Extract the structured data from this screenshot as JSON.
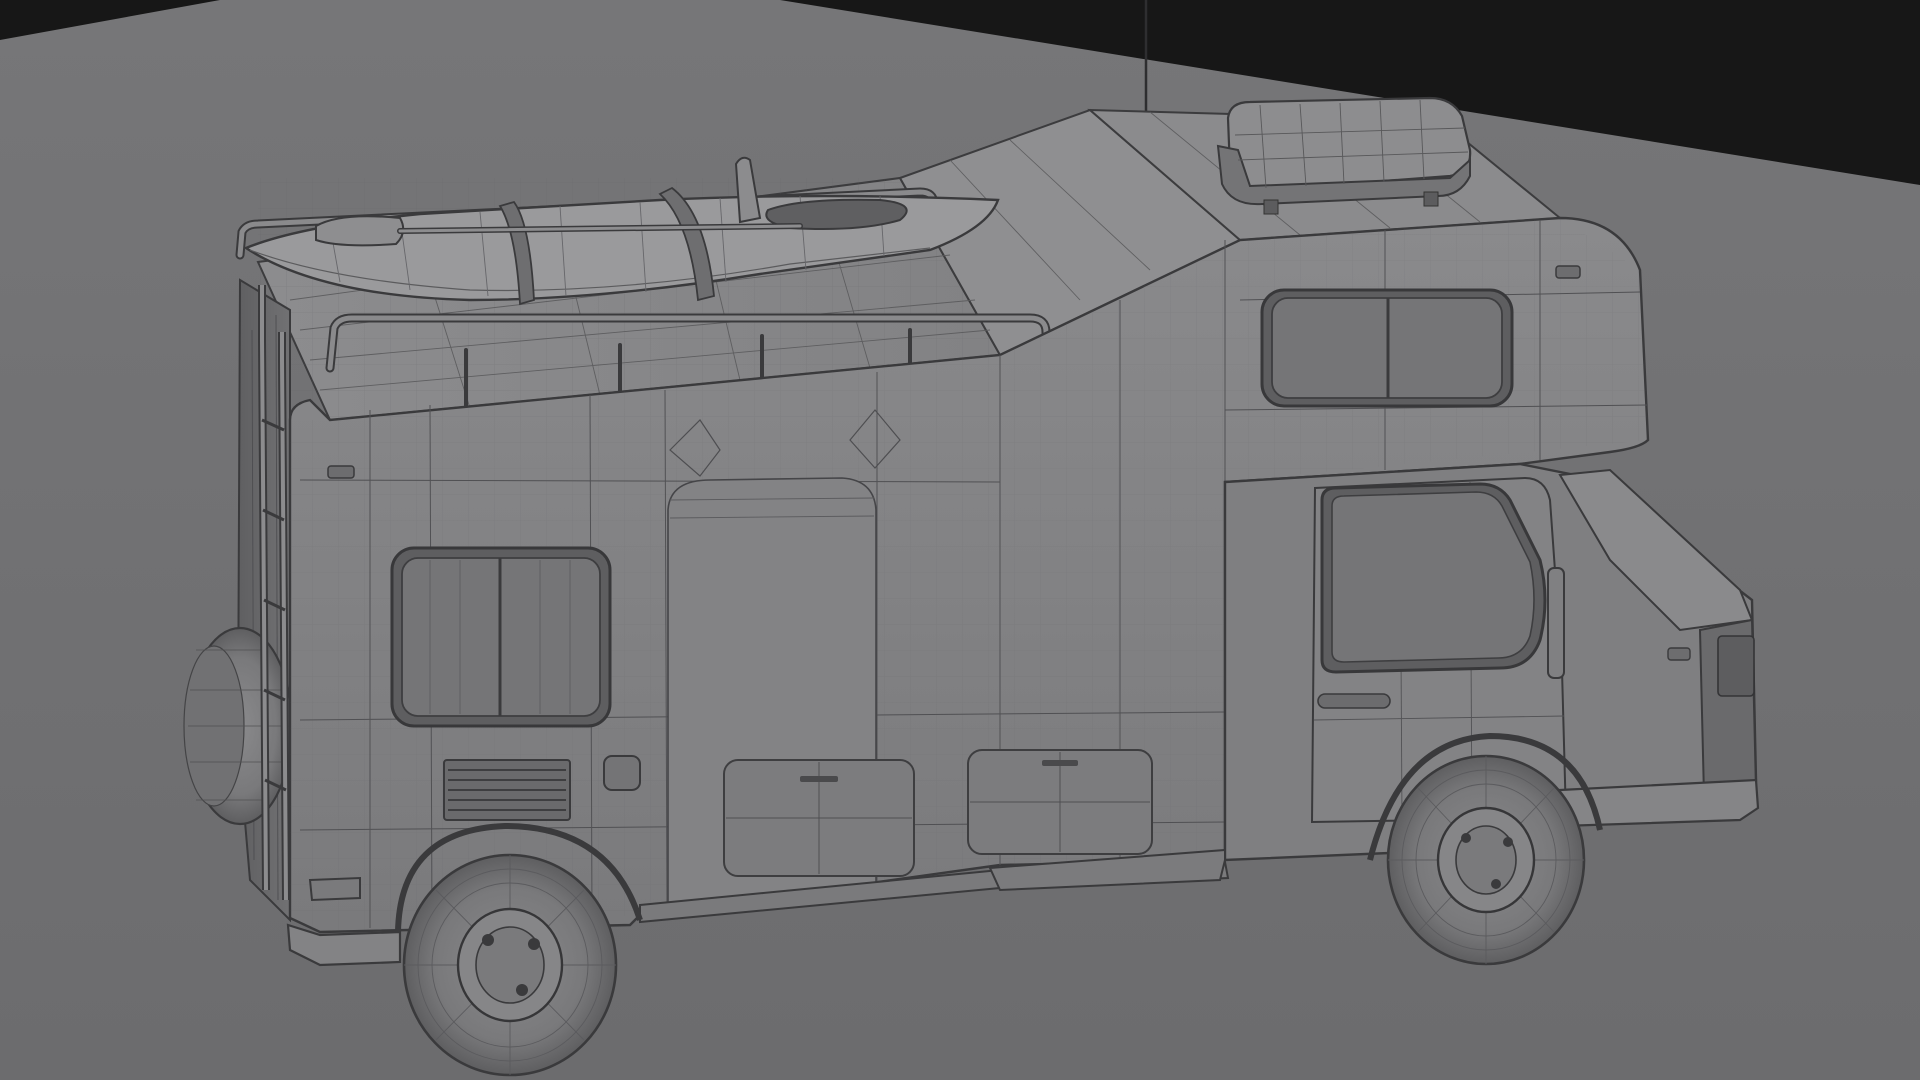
{
  "scene": {
    "subject": "camper-van-wireframe-render",
    "colors": {
      "backdrop_dark": "#171717",
      "ground": "#6f6f70",
      "body_light": "#858587",
      "body_mid": "#7b7b7d",
      "body_dark": "#6a6a6c",
      "wire": "#3c3c3e",
      "wire_light": "#58585a",
      "tire": "#747476",
      "window": "#6b6b6d"
    },
    "objects": [
      "camper-body",
      "overcab-alcove",
      "roof-rack",
      "kayak",
      "paddle",
      "roof-box",
      "antenna",
      "rear-ladder",
      "spare-tire",
      "rear-wheel",
      "front-wheel",
      "side-window",
      "alcove-window",
      "cab-door-window",
      "storage-hatch-left",
      "storage-hatch-right",
      "vent-grille",
      "front-bumper"
    ]
  }
}
